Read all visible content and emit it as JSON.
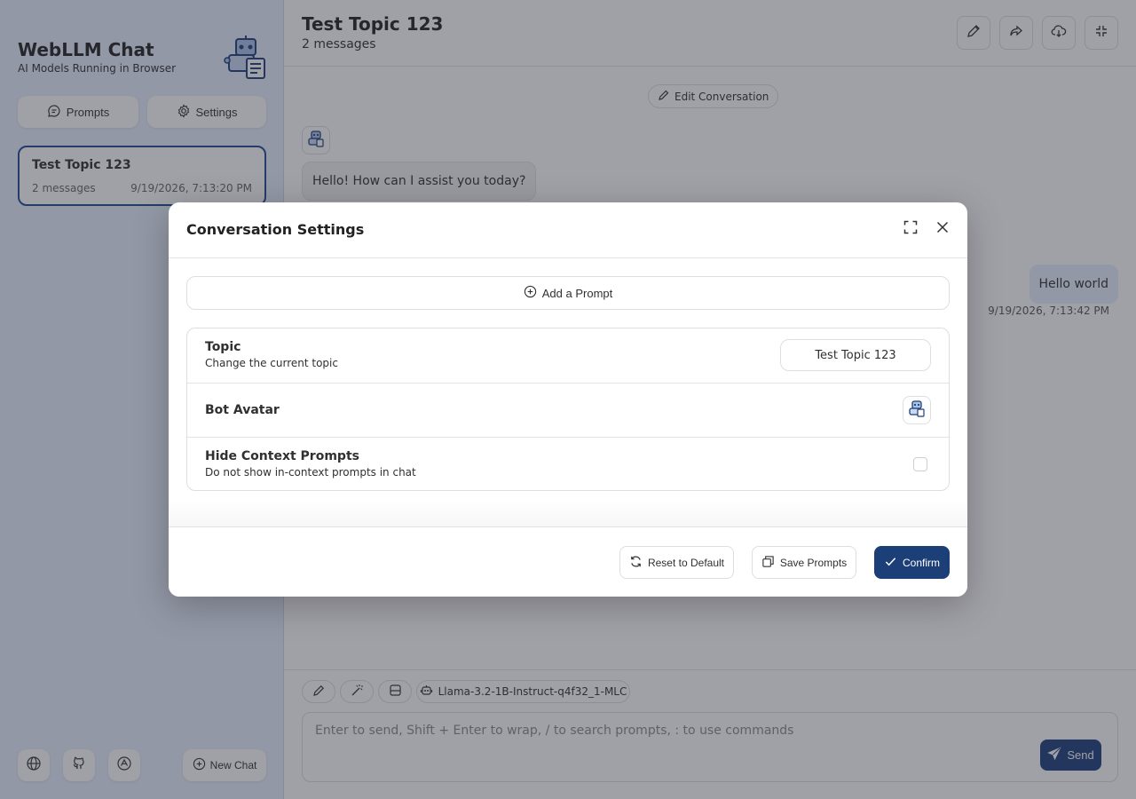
{
  "sidebar": {
    "title": "WebLLM Chat",
    "subtitle": "AI Models Running in Browser",
    "prompts_label": "Prompts",
    "settings_label": "Settings",
    "chats": [
      {
        "title": "Test Topic 123",
        "count": "2 messages",
        "date": "9/19/2026, 7:13:20 PM"
      }
    ],
    "new_chat_label": "New Chat"
  },
  "header": {
    "title": "Test Topic 123",
    "subtitle": "2 messages"
  },
  "chat": {
    "edit_label": "Edit Conversation",
    "messages": [
      {
        "role": "bot",
        "text": "Hello! How can I assist you today?"
      },
      {
        "role": "user",
        "text": "Hello world",
        "date": "9/19/2026, 7:13:42 PM"
      }
    ]
  },
  "composer": {
    "model": "Llama-3.2-1B-Instruct-q4f32_1-MLC",
    "placeholder": "Enter to send, Shift + Enter to wrap, / to search prompts, : to use commands",
    "send_label": "Send"
  },
  "modal": {
    "title": "Conversation Settings",
    "add_prompt_label": "Add a Prompt",
    "topic": {
      "title": "Topic",
      "subtitle": "Change the current topic",
      "value": "Test Topic 123"
    },
    "bot_avatar": {
      "title": "Bot Avatar"
    },
    "hide_context": {
      "title": "Hide Context Prompts",
      "subtitle": "Do not show in-context prompts in chat",
      "checked": false
    },
    "reset_label": "Reset to Default",
    "save_label": "Save Prompts",
    "confirm_label": "Confirm"
  },
  "colors": {
    "accent": "#1d3f78",
    "sidebar_bg": "#e7f0fd",
    "selected_border": "#1d4b8f"
  }
}
